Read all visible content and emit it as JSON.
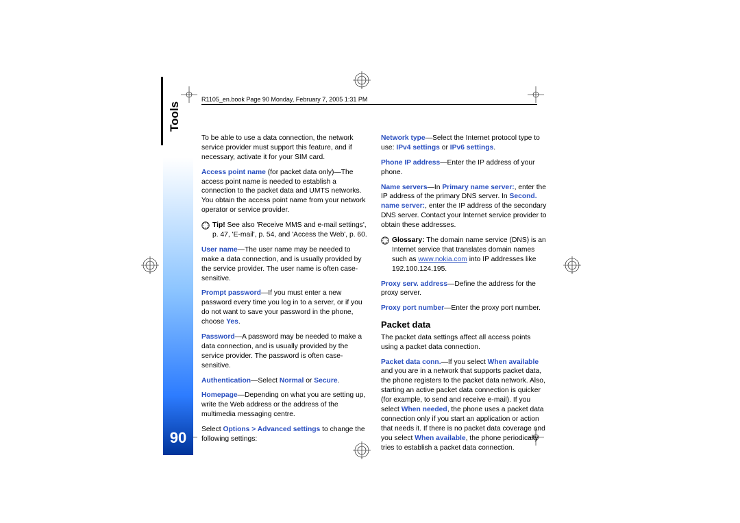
{
  "header": "R1105_en.book  Page 90  Monday, February 7, 2005  1:31 PM",
  "side_tab": "Tools",
  "page_number": "90",
  "left": {
    "p1": "To be able to use a data connection, the network service provider must support this feature, and if necessary, activate it for your SIM card.",
    "apn_label": "Access point name",
    "apn_text": " (for packet data only)—The access point name is needed to establish a connection to the packet data and UMTS networks. You obtain the access point name from your network operator or service provider.",
    "tip_bold": "Tip!",
    "tip_text": " See also 'Receive MMS and e-mail settings', p. 47, 'E-mail', p. 54, and 'Access the Web', p. 60.",
    "user_label": "User name",
    "user_text": "—The user name may be needed to make a data connection, and is usually provided by the service provider. The user name is often case-sensitive.",
    "prompt_label": "Prompt password",
    "prompt_text": "—If you must enter a new password every time you log in to a server, or if you do not want to save your password in the phone, choose ",
    "prompt_yes": "Yes",
    "password_label": "Password",
    "password_text": "—A password may be needed to make a data connection, and is usually provided by the service provider. The password is often case-sensitive.",
    "auth_label": "Authentication",
    "auth_mid": "—Select ",
    "auth_normal": "Normal",
    "auth_or": " or ",
    "auth_secure": "Secure",
    "homepage_label": "Homepage",
    "homepage_text": "—Depending on what you are setting up, write the Web address or the address of the multimedia messaging centre.",
    "select_pre": "Select ",
    "select_opt": "Options > Advanced settings",
    "select_post": " to change the following settings:"
  },
  "right": {
    "net_label": "Network type",
    "net_text": "—Select the Internet protocol type to use: ",
    "net_ipv4": "IPv4 settings",
    "net_or": " or ",
    "net_ipv6": "IPv6 settings",
    "phoneip_label": "Phone IP address",
    "phoneip_text": "—Enter the IP address of your phone.",
    "ns_label": "Name servers",
    "ns_pre": "—In ",
    "ns_primary": "Primary name server:",
    "ns_mid": ", enter the IP address of the primary DNS server. In ",
    "ns_secondary": "Second. name server:",
    "ns_post": ", enter the IP address of the secondary DNS server. Contact your Internet service provider to obtain these addresses.",
    "gloss_bold": "Glossary:",
    "gloss_text1": " The domain name service (DNS) is an Internet service that translates domain names such as ",
    "gloss_link": "www.nokia.com",
    "gloss_text2": " into IP addresses like 192.100.124.195.",
    "proxy_label": "Proxy serv. address",
    "proxy_text": "—Define the address for the proxy server.",
    "port_label": "Proxy port number",
    "port_text": "—Enter the proxy port number.",
    "packet_heading": "Packet data",
    "packet_intro": "The packet data settings affect all access points using a packet data connection.",
    "pdc_label": "Packet data conn.",
    "pdc_pre": "—If you select ",
    "pdc_when_avail": "When available",
    "pdc_mid1": " and you are in a network that supports packet data, the phone registers to the packet data network. Also, starting an active packet data connection is quicker (for example, to send and receive e-mail). If you select ",
    "pdc_when_needed": "When needed",
    "pdc_mid2": ", the phone uses a packet data connection only if you start an application or action that needs it. If there is no packet data coverage and you select ",
    "pdc_when_avail2": "When available",
    "pdc_end": ", the phone periodically tries to establish a packet data connection."
  }
}
